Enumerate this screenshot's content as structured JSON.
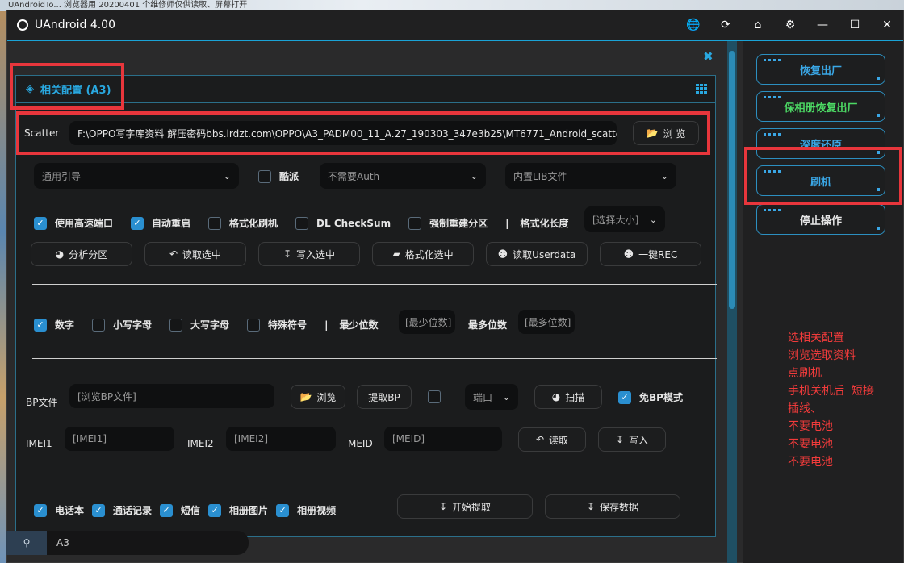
{
  "desktop": {
    "top_text": "UAndroidTo...   浏览器用    20200401 个维修师仅供读取、屏幕打开"
  },
  "window": {
    "title": "UAndroid 4.00"
  },
  "titlebar_icons": [
    "globe-icon",
    "refresh-icon",
    "home-icon",
    "settings-icon",
    "minimize-icon",
    "maximize-icon",
    "close-icon"
  ],
  "panel": {
    "title": "相关配置 (A3)"
  },
  "scatter": {
    "label": "Scatter",
    "path": "F:\\OPPO写字库资料  解压密码bbs.lrdzt.com\\OPPO\\A3_PADM00_11_A.27_190303_347e3b25\\MT6771_Android_scatter.",
    "browse_label": "浏 览"
  },
  "row1": {
    "boot_select": "通用引导",
    "kupai_label": "酷派",
    "auth_select": "不需要Auth",
    "lib_select": "内置LIB文件"
  },
  "row2": {
    "high_speed_label": "使用高速端口",
    "auto_reboot_label": "自动重启",
    "format_flash_label": "格式化刷机",
    "dl_checksum_label": "DL CheckSum",
    "force_rebuild_label": "强制重建分区",
    "separator": "|",
    "format_length_label": "格式化长度",
    "size_select": "[选择大小]"
  },
  "row3": {
    "analyze": "分析分区",
    "read_selected": "读取选中",
    "write_selected": "写入选中",
    "format_selected": "格式化选中",
    "read_userdata": "读取Userdata",
    "one_key_rec": "一键REC"
  },
  "row4": {
    "digits_label": "数字",
    "lower_label": "小写字母",
    "upper_label": "大写字母",
    "special_label": "特殊符号",
    "separator": "|",
    "min_label": "最少位数",
    "min_placeholder": "[最少位数]",
    "max_label": "最多位数",
    "max_placeholder": "[最多位数]"
  },
  "bp": {
    "label": "BP文件",
    "placeholder": "[浏览BP文件]",
    "browse": "浏览",
    "extract": "提取BP",
    "port_select": "端口",
    "scan": "扫描",
    "free_bp_label": "免BP模式"
  },
  "imei": {
    "imei1_label": "IMEI1",
    "imei1_placeholder": "[IMEI1]",
    "imei2_label": "IMEI2",
    "imei2_placeholder": "[IMEI2]",
    "meid_label": "MEID",
    "meid_placeholder": "[MEID]",
    "read": "读取",
    "write": "写入"
  },
  "extract": {
    "contacts_label": "电话本",
    "calls_label": "通话记录",
    "sms_label": "短信",
    "photos_label": "相册图片",
    "videos_label": "相册视频",
    "start": "开始提取",
    "save": "保存数据"
  },
  "sidebar": {
    "factory_reset": "恢复出厂",
    "keep_album_reset": "保相册恢复出厂",
    "deep_restore": "深度还原",
    "flash": "刷机",
    "stop": "停止操作"
  },
  "annotation_note": "选相关配置\n浏览选取资料\n点刷机\n手机关机后  短接\n插线、\n不要电池\n不要电池\n不要电池",
  "search": {
    "value": "A3"
  },
  "colors": {
    "accent": "#29a8e0",
    "green": "#4cd964",
    "annotation_red": "#e8363c",
    "checkbox_on": "#2a8fd0"
  }
}
